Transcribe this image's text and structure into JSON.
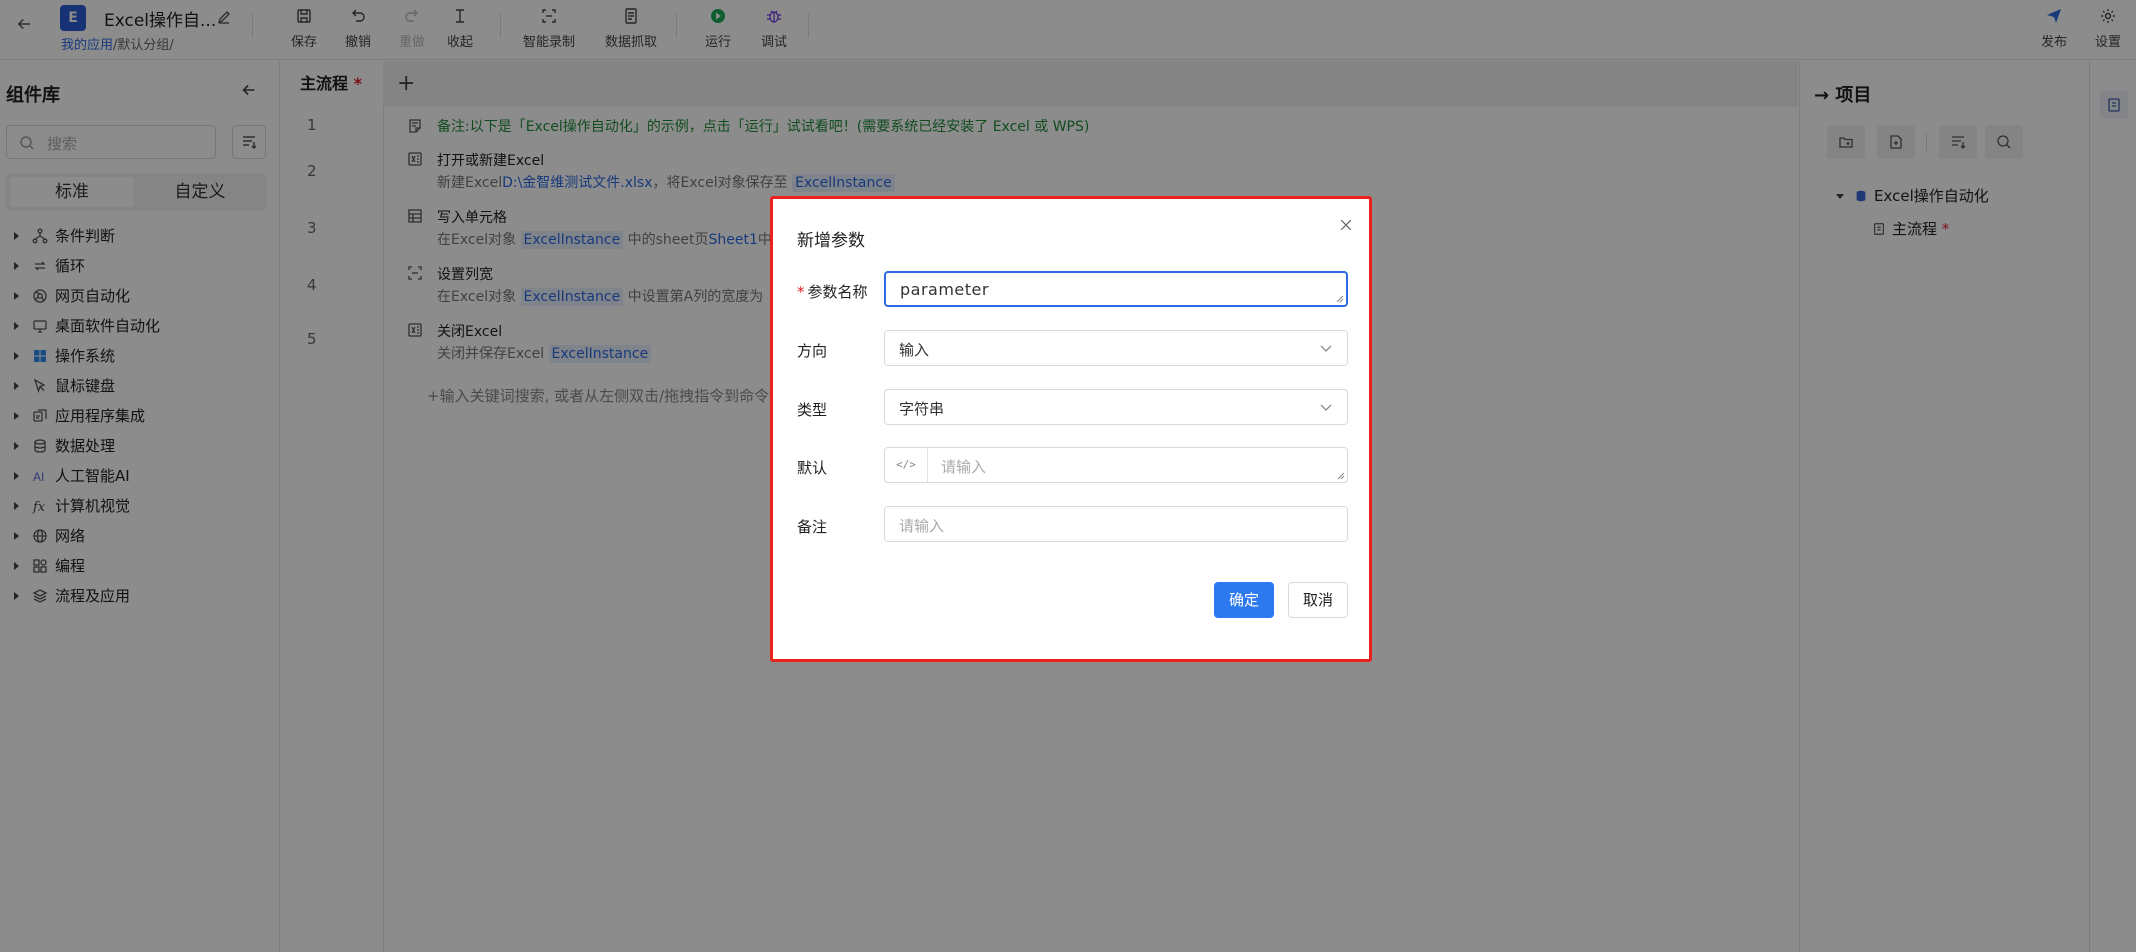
{
  "header": {
    "app_logo_letter": "E",
    "app_title": "Excel操作自...",
    "breadcrumb_link": "我的应用",
    "breadcrumb_rest": "/默认分组/",
    "tools": {
      "save": "保存",
      "undo": "撤销",
      "redo": "重做",
      "collapse": "收起",
      "smart_record": "智能录制",
      "data_grab": "数据抓取",
      "run": "运行",
      "debug": "调试",
      "publish": "发布",
      "settings": "设置"
    }
  },
  "sidebar": {
    "title": "组件库",
    "search_placeholder": "搜索",
    "seg_standard": "标准",
    "seg_custom": "自定义",
    "categories": [
      {
        "label": "条件判断"
      },
      {
        "label": "循环"
      },
      {
        "label": "网页自动化"
      },
      {
        "label": "桌面软件自动化"
      },
      {
        "label": "操作系统"
      },
      {
        "label": "鼠标键盘"
      },
      {
        "label": "应用程序集成"
      },
      {
        "label": "数据处理"
      },
      {
        "label": "人工智能AI"
      },
      {
        "label": "计算机视觉"
      },
      {
        "label": "网络"
      },
      {
        "label": "编程"
      },
      {
        "label": "流程及应用"
      }
    ]
  },
  "editor": {
    "tab_label": "主流程",
    "tab_star": "*",
    "tab_add": "+",
    "note": "备注:以下是「Excel操作自动化」的示例，点击「运行」试试看吧！(需要系统已经安装了 Excel 或 WPS)",
    "steps": [
      {
        "no": "1"
      },
      {
        "no": "2",
        "title": "打开或新建Excel",
        "d1": "新建Excel",
        "d2": "D:\\金智维测试文件.xlsx",
        "d3": "，将Excel对象保存至",
        "var": "ExcelInstance"
      },
      {
        "no": "3",
        "title": "写入单元格",
        "d1": "在Excel对象",
        "var": "ExcelInstance",
        "d2": "中的sheet页",
        "d3": "Sheet1",
        "d4": "中"
      },
      {
        "no": "4",
        "title": "设置列宽",
        "d1": "在Excel对象",
        "var": "ExcelInstance",
        "d2": "中设置第A列的宽度为"
      },
      {
        "no": "5",
        "title": "关闭Excel",
        "d1": "关闭并保存Excel",
        "var": "ExcelInstance"
      }
    ],
    "input_hint": "+输入关键词搜索, 或者从左侧双击/拖拽指令到命令"
  },
  "project": {
    "title": "项目",
    "root": "Excel操作自动化",
    "child": "主流程",
    "child_star": "*"
  },
  "dialog": {
    "title": "新增参数",
    "name_label": "参数名称",
    "required_mark": "*",
    "name_value": "parameter",
    "direction_label": "方向",
    "direction_value": "输入",
    "type_label": "类型",
    "type_value": "字符串",
    "default_label": "默认",
    "default_placeholder": "请输入",
    "code_icon": "</>",
    "remark_label": "备注",
    "remark_placeholder": "请输入",
    "ok_label": "确定",
    "cancel_label": "取消"
  },
  "colors": {
    "accent": "#2d7af0",
    "link": "#2d6be4",
    "note_green": "#1f8a3a",
    "highlight_border": "#e8231e"
  }
}
